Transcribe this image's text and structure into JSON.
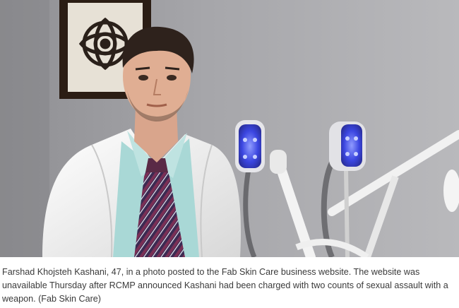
{
  "photo": {
    "alt": "Man in a white lab coat and striped tie seated in a clinic room with skin care devices"
  },
  "caption": {
    "text": "Farshad Khojsteh Kashani, 47, in a photo posted to the Fab Skin Care business website. The website was unavailable Thursday after RCMP announced Kashani had been charged with two counts of sexual assault with a weapon. (Fab Skin Care)"
  },
  "colors": {
    "wall": "#a3a3a6",
    "coat": "#f2f2f0",
    "shirt": "#a9d8d6",
    "tie_stripe": "#5a2a46",
    "device_glow": "#4d5cff",
    "caption_text": "#3a3a3a"
  }
}
